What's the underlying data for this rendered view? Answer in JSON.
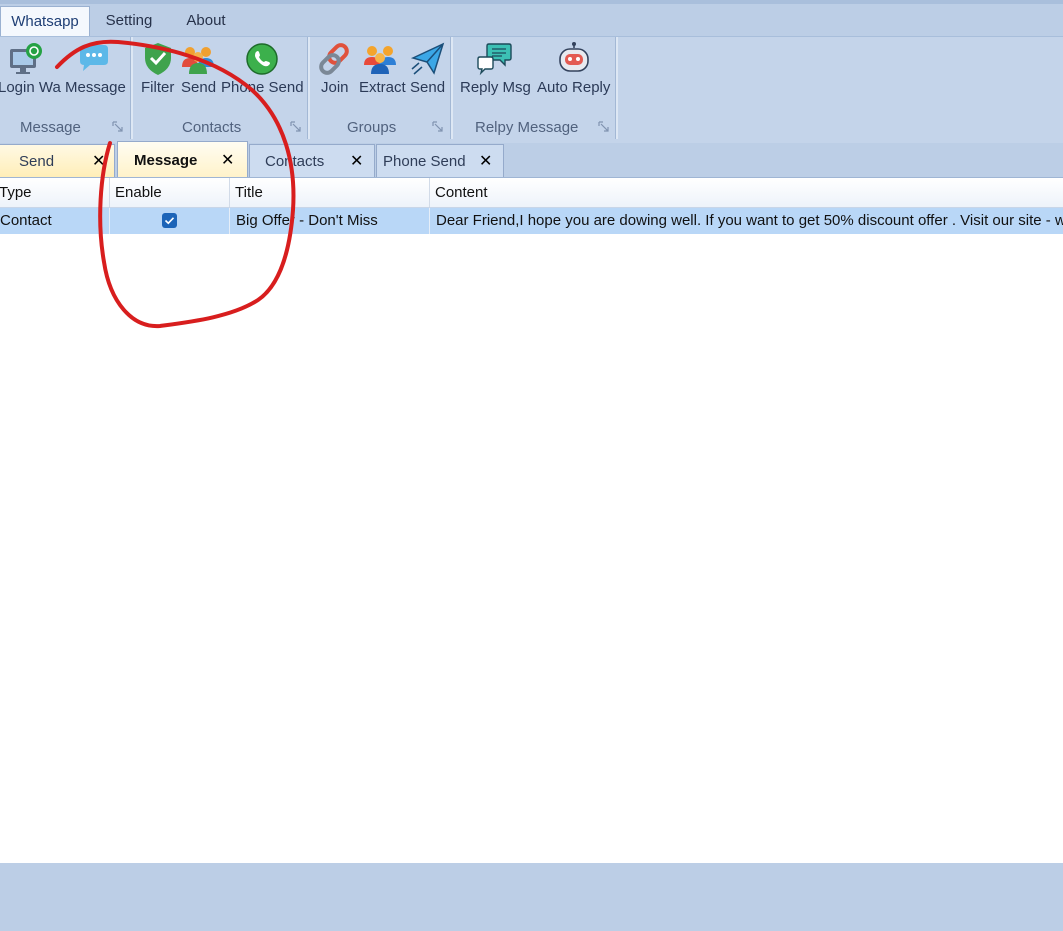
{
  "menu": {
    "tabs": [
      {
        "label": "Whatsapp"
      },
      {
        "label": "Setting"
      },
      {
        "label": "About"
      }
    ]
  },
  "ribbon": {
    "groups": [
      {
        "label": "Message",
        "buttons": [
          {
            "label": "Login Wa",
            "icon": "monitor-whatsapp-icon"
          },
          {
            "label": "Message",
            "icon": "chat-bubble-icon"
          }
        ]
      },
      {
        "label": "Contacts",
        "buttons": [
          {
            "label": "Filter",
            "icon": "shield-check-icon"
          },
          {
            "label": "Send",
            "icon": "people-icon"
          },
          {
            "label": "Phone Send",
            "icon": "phone-icon"
          }
        ]
      },
      {
        "label": "Groups",
        "buttons": [
          {
            "label": "Join",
            "icon": "link-icon"
          },
          {
            "label": "Extract",
            "icon": "group-icon"
          },
          {
            "label": "Send",
            "icon": "paper-plane-icon"
          }
        ]
      },
      {
        "label": "Relpy Message",
        "buttons": [
          {
            "label": "Reply Msg",
            "icon": "reply-chat-icon"
          },
          {
            "label": "Auto Reply",
            "icon": "robot-icon"
          }
        ]
      }
    ]
  },
  "doc_tabs": [
    {
      "label": "Send",
      "close": "✕"
    },
    {
      "label": "Message",
      "close": "✕"
    },
    {
      "label": "Contacts",
      "close": "✕"
    },
    {
      "label": "Phone Send",
      "close": "✕"
    }
  ],
  "grid": {
    "columns": [
      "Type",
      "Enable",
      "Title",
      "Content"
    ],
    "rows": [
      {
        "type": "Contact",
        "enabled": true,
        "title": "Big Offer - Don't Miss",
        "content": "Dear Friend,I hope you are dowing well. If you want to get 50% discount offer . Visit our site - w"
      }
    ]
  },
  "colors": {
    "ribbon_bg": "#c4d4ea",
    "selected_row": "#b9d7f7",
    "active_tab": "#fff2c9",
    "annotation": "#d81e1e"
  }
}
